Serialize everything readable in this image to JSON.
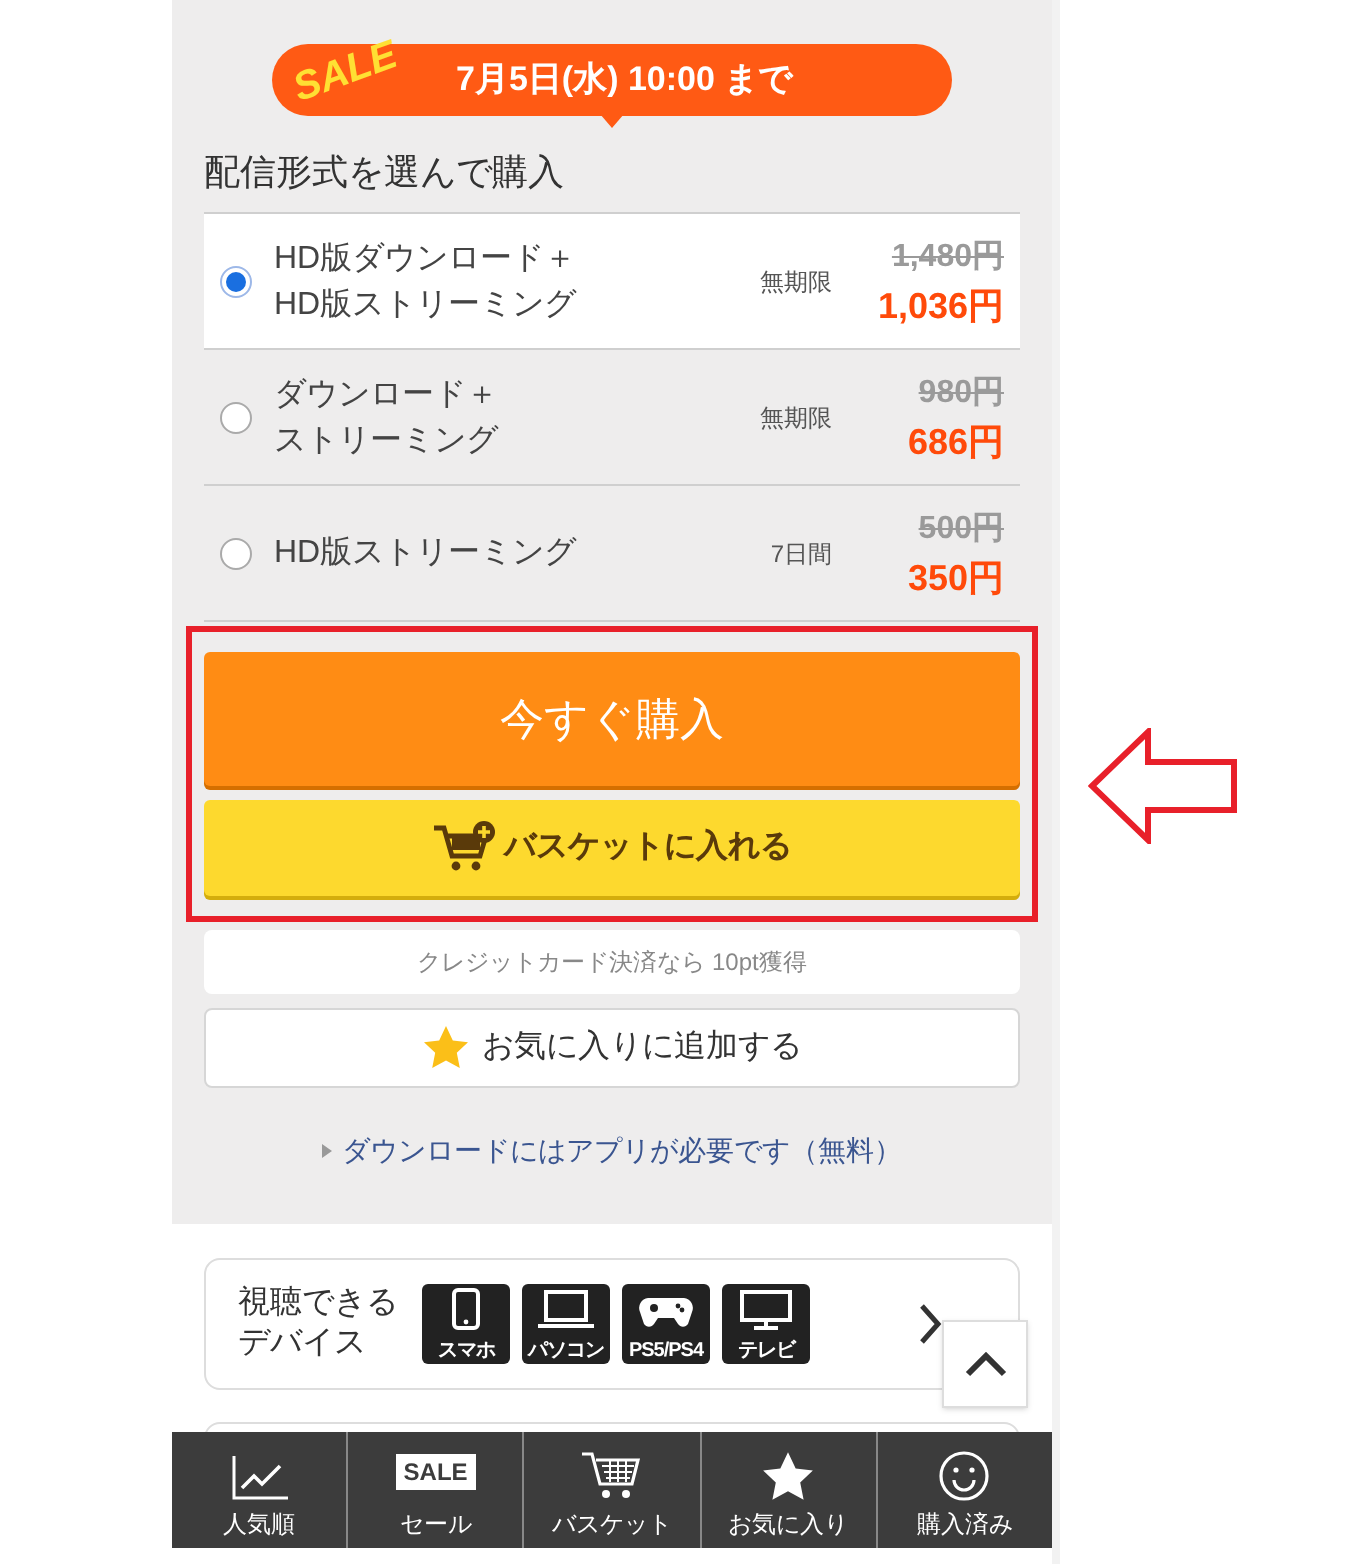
{
  "sale_banner": {
    "badge": "SALE",
    "deadline": "7月5日(水) 10:00 まで"
  },
  "heading": "配信形式を選んで購入",
  "options": [
    {
      "label_lines": [
        "HD版ダウンロード＋",
        "HD版ストリーミング"
      ],
      "period": "無期限",
      "original_price": "1,480円",
      "sale_price": "1,036円",
      "selected": true
    },
    {
      "label_lines": [
        "ダウンロード＋",
        "ストリーミング"
      ],
      "period": "無期限",
      "original_price": "980円",
      "sale_price": "686円",
      "selected": false
    },
    {
      "label_lines": [
        "HD版ストリーミング"
      ],
      "period": "7日間",
      "original_price": "500円",
      "sale_price": "350円",
      "selected": false
    }
  ],
  "buy_button": "今すぐ購入",
  "basket_button": "バスケットに入れる",
  "credit_note": "クレジットカード決済なら 10pt獲得",
  "favorite_button": "お気に入りに追加する",
  "app_note": "ダウンロードにはアプリが必要です（無料）",
  "devices": {
    "label_lines": [
      "視聴できる",
      "デバイス"
    ],
    "items": [
      {
        "kind": "phone",
        "label": "スマホ"
      },
      {
        "kind": "laptop",
        "label": "パソコン"
      },
      {
        "kind": "gamepad",
        "label": "PS5/PS4"
      },
      {
        "kind": "tv",
        "label": "テレビ"
      }
    ]
  },
  "bottom_nav": [
    {
      "kind": "chart",
      "label": "人気順"
    },
    {
      "kind": "sale",
      "label": "セール",
      "icon_text": "SALE"
    },
    {
      "kind": "cart",
      "label": "バスケット"
    },
    {
      "kind": "star",
      "label": "お気に入り"
    },
    {
      "kind": "smile",
      "label": "購入済み"
    }
  ]
}
